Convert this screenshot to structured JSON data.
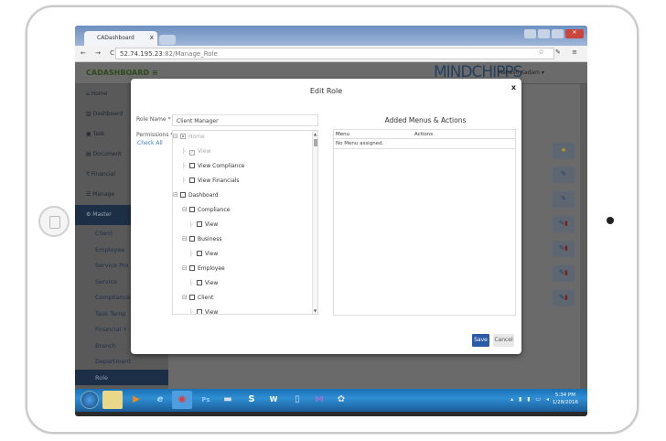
{
  "browser": {
    "tab_title": "CADashboard",
    "tab_close": "x",
    "url_host": "52.74.195.23",
    "url_path": ":82/Manage_Role",
    "nav_symbols": "← → C",
    "right_symbols": "☆ ✎ ≡"
  },
  "app": {
    "logo": "CADASHBOARD ≡",
    "brand": "MINDCHIPPS",
    "user": "Mahesh Kadam ▾"
  },
  "sidebar": {
    "items": [
      {
        "label": "⌂ Home"
      },
      {
        "label": "▥ Dashboard"
      },
      {
        "label": "▣ Task"
      },
      {
        "label": "▤ Document"
      },
      {
        "label": "₹ Financial"
      },
      {
        "label": "☰ Manage"
      },
      {
        "label": "⚙ Master"
      }
    ],
    "subitems": [
      {
        "label": "Client"
      },
      {
        "label": "Employee"
      },
      {
        "label": "Service Pro"
      },
      {
        "label": "Service"
      },
      {
        "label": "Compliance"
      },
      {
        "label": "Task Temp"
      },
      {
        "label": "Financial Y"
      },
      {
        "label": "Branch"
      },
      {
        "label": "Department"
      },
      {
        "label": "Role"
      }
    ]
  },
  "modal": {
    "title": "Edit Role",
    "close": "x",
    "role_name_label": "Role Name *",
    "role_name_value": "Client Manager",
    "permissions_label": "Permissions *",
    "check_all": "Check All",
    "tree": [
      {
        "label": "Home",
        "level": 0,
        "checked": "partial",
        "disabled": true
      },
      {
        "label": "View",
        "level": 1,
        "checked": true,
        "disabled": true
      },
      {
        "label": "View Compliance",
        "level": 1,
        "checked": false
      },
      {
        "label": "View Financials",
        "level": 1,
        "checked": false
      },
      {
        "label": "Dashboard",
        "level": 0,
        "checked": false
      },
      {
        "label": "Compliance",
        "level": 1,
        "checked": false
      },
      {
        "label": "View",
        "level": 2,
        "checked": false
      },
      {
        "label": "Business",
        "level": 1,
        "checked": false
      },
      {
        "label": "View",
        "level": 2,
        "checked": false
      },
      {
        "label": "Employee",
        "level": 1,
        "checked": false
      },
      {
        "label": "View",
        "level": 2,
        "checked": false
      },
      {
        "label": "Client",
        "level": 1,
        "checked": false
      },
      {
        "label": "View",
        "level": 2,
        "checked": false
      }
    ],
    "added_title": "Added Menus & Actions",
    "table_headers": [
      "Menu",
      "Actions"
    ],
    "empty_text": "No Menu assigned.",
    "save": "Save",
    "cancel": "Cancel"
  },
  "taskbar": {
    "time": "5:34 PM",
    "date": "1/28/2016"
  }
}
